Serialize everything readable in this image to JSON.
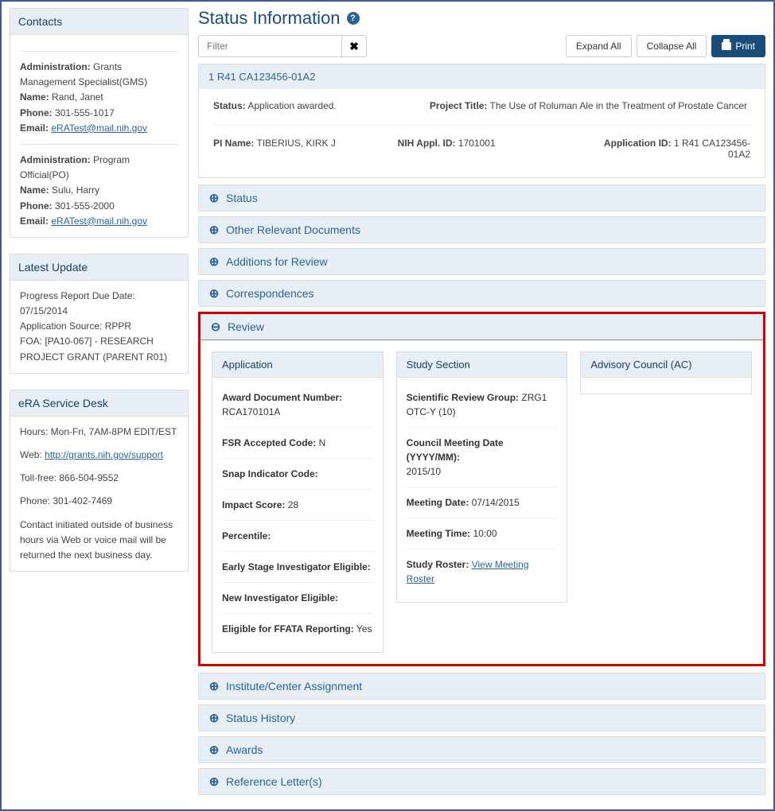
{
  "page": {
    "title": "Status Information",
    "filter_placeholder": "Filter",
    "expand_all": "Expand All",
    "collapse_all": "Collapse All",
    "print": "Print"
  },
  "contacts": {
    "header": "Contacts",
    "admin1_label": "Administration:",
    "admin1_value": "Grants Management Specialist(GMS)",
    "name1_label": "Name:",
    "name1_value": "Rand, Janet",
    "phone1_label": "Phone:",
    "phone1_value": "301-555-1017",
    "email1_label": "Email:",
    "email1_value": "eRATest@mail.nih.gov",
    "admin2_label": "Administration:",
    "admin2_value": "Program Official(PO)",
    "name2_label": "Name:",
    "name2_value": "Sulu, Harry",
    "phone2_label": "Phone:",
    "phone2_value": "301-555-2000",
    "email2_label": "Email:",
    "email2_value": "eRATest@mail.nih.gov"
  },
  "latest_update": {
    "header": "Latest Update",
    "line1": "Progress Report Due Date: 07/15/2014",
    "line2": "Application Source: RPPR",
    "line3": "FOA: [PA10-067] -  RESEARCH PROJECT GRANT (PARENT R01)"
  },
  "service_desk": {
    "header": "eRA Service Desk",
    "hours": "Hours: Mon-Fri, 7AM-8PM EDIT/EST",
    "web_label": "Web:",
    "web_link": "http://grants.nih.gov/support",
    "tollfree": "Toll-free: 866-504-9552",
    "phone": "Phone: 301-402-7469",
    "note": "Contact initiated outside of business hours via Web or voice mail will be returned the next business day."
  },
  "app_header": {
    "id_title": "1 R41 CA123456-01A2",
    "status_label": "Status:",
    "status_value": "Application awarded.",
    "project_title_label": "Project Title:",
    "project_title_value": "The Use of Roluman Ale in the Treatment of Prostate Cancer",
    "pi_name_label": "PI Name:",
    "pi_name_value": "TIBERIUS, KIRK J",
    "nih_appl_id_label": "NIH Appl. ID:",
    "nih_appl_id_value": "1701001",
    "application_id_label": "Application ID:",
    "application_id_value": "1 R41 CA123456-01A2"
  },
  "accordions": {
    "status": "Status",
    "documents": "Other Relevant Documents",
    "additions": "Additions for Review",
    "correspondences": "Correspondences",
    "review": "Review",
    "institute": "Institute/Center Assignment",
    "history": "Status History",
    "awards": "Awards",
    "reference": "Reference Letter(s)"
  },
  "review": {
    "application": {
      "header": "Application",
      "award_doc_label": "Award Document Number:",
      "award_doc_value": "RCA170101A",
      "fsr_label": "FSR Accepted Code:",
      "fsr_value": "N",
      "snap_label": "Snap Indicator Code:",
      "snap_value": "",
      "impact_label": "Impact Score:",
      "impact_value": "28",
      "percentile_label": "Percentile:",
      "percentile_value": "",
      "esi_label": "Early Stage Investigator Eligible:",
      "esi_value": "",
      "ni_label": "New Investigator Eligible:",
      "ni_value": "",
      "ffata_label": "Eligible for FFATA Reporting:",
      "ffata_value": "Yes"
    },
    "study_section": {
      "header": "Study Section",
      "srg_label": "Scientific Review Group:",
      "srg_value": "ZRG1 OTC-Y (10)",
      "council_date_label": "Council Meeting Date (YYYY/MM):",
      "council_date_value": "2015/10",
      "meeting_date_label": "Meeting Date:",
      "meeting_date_value": "07/14/2015",
      "meeting_time_label": "Meeting Time:",
      "meeting_time_value": "10:00",
      "roster_label": "Study Roster:",
      "roster_link": "View Meeting Roster"
    },
    "advisory": {
      "header": "Advisory Council (AC)"
    }
  }
}
